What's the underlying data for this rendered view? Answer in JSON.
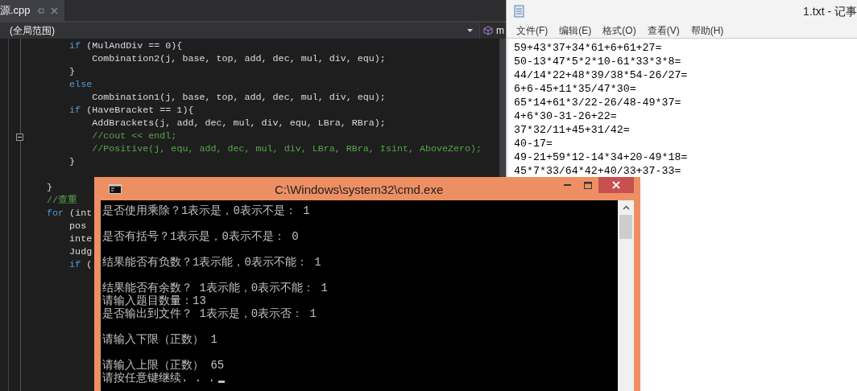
{
  "editor": {
    "tab": {
      "title": "源.cpp",
      "selected": true
    },
    "scope_dropdown": {
      "value": "(全局范围)"
    },
    "member_dropdown": {
      "value": "m"
    },
    "code_blocks": [
      [
        {
          "fold": false,
          "tokens": [
            {
              "kind": "keyword",
              "text": "        if"
            },
            {
              "kind": "plain",
              "text": " (MulAndDiv == 0){"
            }
          ]
        },
        {
          "fold": false,
          "tokens": [
            {
              "kind": "plain",
              "text": "            Combination2(j, base, top, add, dec, mul, div, equ);"
            }
          ]
        },
        {
          "fold": false,
          "tokens": [
            {
              "kind": "plain",
              "text": "        }"
            }
          ]
        },
        {
          "fold": false,
          "tokens": [
            {
              "kind": "keyword",
              "text": "        else"
            }
          ]
        },
        {
          "fold": false,
          "tokens": [
            {
              "kind": "plain",
              "text": "            Combination1(j, base, top, add, dec, mul, div, equ);"
            }
          ]
        },
        {
          "fold": false,
          "tokens": [
            {
              "kind": "keyword",
              "text": "        if"
            },
            {
              "kind": "plain",
              "text": " (HaveBracket == 1){"
            }
          ]
        },
        {
          "fold": false,
          "tokens": [
            {
              "kind": "plain",
              "text": "            AddBrackets(j, add, dec, mul, div, equ, LBra, RBra);"
            }
          ]
        },
        {
          "fold": true,
          "tokens": [
            {
              "kind": "comment",
              "text": "            //cout << endl;"
            }
          ]
        },
        {
          "fold": false,
          "tokens": [
            {
              "kind": "comment",
              "text": "            //Positive(j, equ, add, dec, mul, div, LBra, RBra, Isint, AboveZero);"
            }
          ]
        },
        {
          "fold": false,
          "tokens": [
            {
              "kind": "plain",
              "text": "        }"
            }
          ]
        }
      ],
      [
        {
          "fold": false,
          "tokens": [
            {
              "kind": "plain",
              "text": "    }"
            }
          ]
        },
        {
          "fold": false,
          "tokens": [
            {
              "kind": "comment",
              "text": "    //查重"
            }
          ]
        },
        {
          "fold": false,
          "tokens": [
            {
              "kind": "keyword",
              "text": "    for"
            },
            {
              "kind": "plain",
              "text": " (int"
            }
          ]
        },
        {
          "fold": false,
          "tokens": [
            {
              "kind": "plain",
              "text": "        pos"
            }
          ]
        },
        {
          "fold": false,
          "tokens": [
            {
              "kind": "plain",
              "text": "        inte"
            }
          ]
        },
        {
          "fold": false,
          "tokens": [
            {
              "kind": "plain",
              "text": "        Judg"
            }
          ]
        },
        {
          "fold": false,
          "tokens": [
            {
              "kind": "keyword",
              "text": "        if"
            },
            {
              "kind": "plain",
              "text": " ("
            }
          ]
        }
      ]
    ]
  },
  "notepad": {
    "title": "1.txt - 记事",
    "menu": [
      "文件(F)",
      "编辑(E)",
      "格式(O)",
      "查看(V)",
      "帮助(H)"
    ],
    "lines": [
      "59+43*37+34*61+6+61+27=",
      "50-13*47*5*2*10-61*33*3*8=",
      "44/14*22+48*39/38*54-26/27=",
      "6+6-45+11*35/47*30=",
      "65*14+61*3/22-26/48-49*37=",
      "4+6*30-31-26+22=",
      "37*32/11+45+31/42=",
      "40-17=",
      "49-21+59*12-14*34+20-49*18=",
      "45*7*33/64*42+40/33+37-33="
    ]
  },
  "console": {
    "title": "C:\\Windows\\system32\\cmd.exe",
    "blocks": [
      [
        "是否使用乘除？1表示是，0表示不是： 1"
      ],
      [
        "是否有括号？1表示是，0表示不是： 0"
      ],
      [
        "结果能否有负数？1表示能，0表示不能： 1"
      ],
      [
        "结果能否有余数？ 1表示能，0表示不能： 1",
        "请输入题目数量：13",
        "是否输出到文件？ 1表示是，0表示否： 1"
      ],
      [
        "请输入下限（正数） 1"
      ],
      [
        "请输入上限（正数） 65",
        "请按任意键继续. . ."
      ]
    ]
  }
}
